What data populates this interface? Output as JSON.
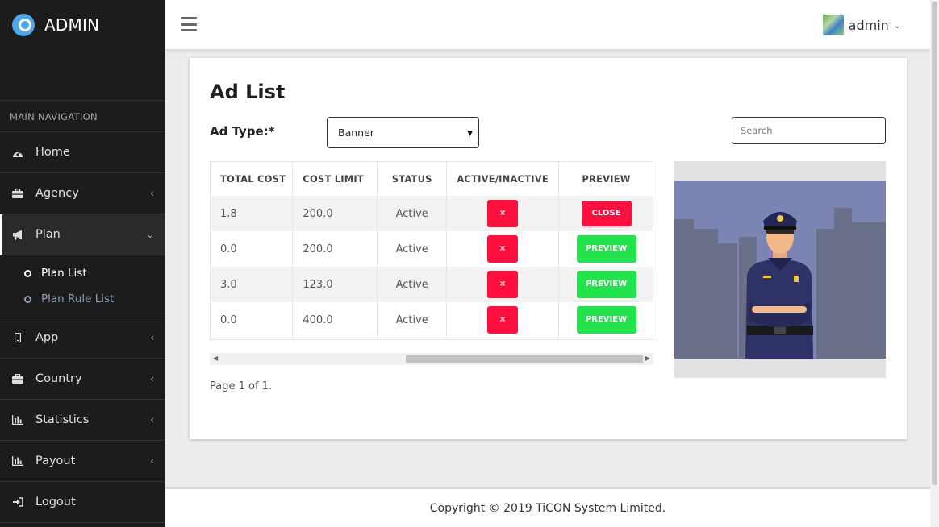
{
  "brand": {
    "name": "ADMIN"
  },
  "sidebar": {
    "header": "MAIN NAVIGATION",
    "items": [
      {
        "label": "Home",
        "icon": "dashboard-icon"
      },
      {
        "label": "Agency",
        "icon": "briefcase-icon",
        "chevron": "‹"
      },
      {
        "label": "Plan",
        "icon": "bullhorn-icon",
        "chevron": "⌄"
      },
      {
        "label": "App",
        "icon": "mobile-icon",
        "chevron": "‹"
      },
      {
        "label": "Country",
        "icon": "briefcase-icon",
        "chevron": "‹"
      },
      {
        "label": "Statistics",
        "icon": "bar-chart-icon",
        "chevron": "‹"
      },
      {
        "label": "Payout",
        "icon": "bar-chart-icon",
        "chevron": "‹"
      },
      {
        "label": "Logout",
        "icon": "logout-icon"
      }
    ],
    "plan_subitems": [
      {
        "label": "Plan List"
      },
      {
        "label": "Plan Rule List"
      }
    ]
  },
  "topbar": {
    "username": "admin"
  },
  "main": {
    "title": "Ad List",
    "ad_type_label": "Ad Type:*",
    "ad_type_selected": "Banner",
    "search_placeholder": "Search",
    "columns": [
      "TOTAL COST",
      "COST LIMIT",
      "STATUS",
      "ACTIVE/INACTIVE",
      "PREVIEW"
    ],
    "rows": [
      {
        "total_cost": "1.8",
        "cost_limit": "200.0",
        "status": "Active",
        "toggle": "×",
        "preview": "CLOSE"
      },
      {
        "total_cost": "0.0",
        "cost_limit": "200.0",
        "status": "Active",
        "toggle": "×",
        "preview": "PREVIEW"
      },
      {
        "total_cost": "3.0",
        "cost_limit": "123.0",
        "status": "Active",
        "toggle": "×",
        "preview": "PREVIEW"
      },
      {
        "total_cost": "0.0",
        "cost_limit": "400.0",
        "status": "Active",
        "toggle": "×",
        "preview": "PREVIEW"
      }
    ],
    "page_info": "Page 1 of 1."
  },
  "footer": {
    "copyright": "Copyright © 2019 TiCON System Limited."
  },
  "colors": {
    "danger": "#ff0f3d",
    "success": "#22e34c",
    "sidebar": "#1c1c1c",
    "preview_bg": "#7b84b3"
  }
}
